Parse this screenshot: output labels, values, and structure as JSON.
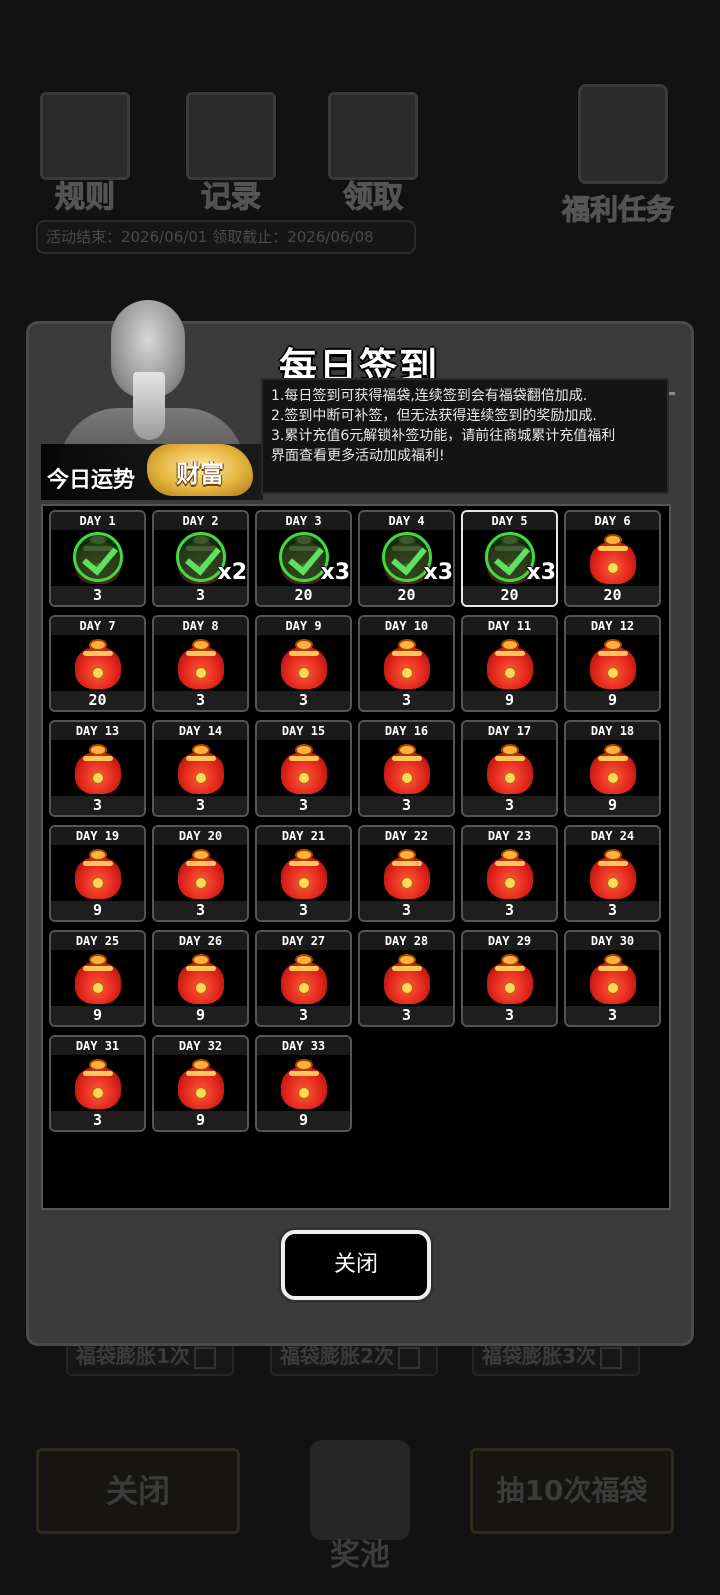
{
  "background": {
    "top_icons": [
      {
        "label": "规则",
        "icon": "rulebook-icon"
      },
      {
        "label": "记录",
        "icon": "record-icon"
      },
      {
        "label": "领取",
        "icon": "claim-icon"
      }
    ],
    "welfare_task": {
      "label": "福利任务",
      "icon": "target-icon"
    },
    "activity_text": "活动结束：2026/06/01  领取截止：2026/06/08",
    "expand_options": [
      "福袋膨胀1次",
      "福袋膨胀2次",
      "福袋膨胀3次"
    ],
    "bottom_close_label": "关闭",
    "prize_pool_label": "奖池",
    "draw10_label": "抽10次福袋"
  },
  "modal": {
    "title": "每日签到",
    "fortune_label": "今日运势",
    "fortune_value": "财富",
    "rules": [
      "1.每日签到可获得福袋,连续签到会有福袋翻倍加成.",
      "2.签到中断可补签，但无法获得连续签到的奖励加成.",
      "3.累计充值6元解锁补签功能，请前往商城累计充值福利",
      "界面查看更多活动加成福利!"
    ],
    "close_label": "关闭"
  },
  "days": [
    {
      "day": "DAY 1",
      "amount": "3",
      "signed": true,
      "mult": ""
    },
    {
      "day": "DAY 2",
      "amount": "3",
      "signed": true,
      "mult": "x2"
    },
    {
      "day": "DAY 3",
      "amount": "20",
      "signed": true,
      "mult": "x3"
    },
    {
      "day": "DAY 4",
      "amount": "20",
      "signed": true,
      "mult": "x3"
    },
    {
      "day": "DAY 5",
      "amount": "20",
      "signed": true,
      "mult": "x3",
      "selected": true
    },
    {
      "day": "DAY 6",
      "amount": "20"
    },
    {
      "day": "DAY 7",
      "amount": "20"
    },
    {
      "day": "DAY 8",
      "amount": "3"
    },
    {
      "day": "DAY 9",
      "amount": "3"
    },
    {
      "day": "DAY 10",
      "amount": "3"
    },
    {
      "day": "DAY 11",
      "amount": "9"
    },
    {
      "day": "DAY 12",
      "amount": "9"
    },
    {
      "day": "DAY 13",
      "amount": "3"
    },
    {
      "day": "DAY 14",
      "amount": "3"
    },
    {
      "day": "DAY 15",
      "amount": "3"
    },
    {
      "day": "DAY 16",
      "amount": "3"
    },
    {
      "day": "DAY 17",
      "amount": "3"
    },
    {
      "day": "DAY 18",
      "amount": "9"
    },
    {
      "day": "DAY 19",
      "amount": "9"
    },
    {
      "day": "DAY 20",
      "amount": "3"
    },
    {
      "day": "DAY 21",
      "amount": "3"
    },
    {
      "day": "DAY 22",
      "amount": "3"
    },
    {
      "day": "DAY 23",
      "amount": "3"
    },
    {
      "day": "DAY 24",
      "amount": "3"
    },
    {
      "day": "DAY 25",
      "amount": "9"
    },
    {
      "day": "DAY 26",
      "amount": "9"
    },
    {
      "day": "DAY 27",
      "amount": "3"
    },
    {
      "day": "DAY 28",
      "amount": "3"
    },
    {
      "day": "DAY 29",
      "amount": "3"
    },
    {
      "day": "DAY 30",
      "amount": "3"
    },
    {
      "day": "DAY 31",
      "amount": "3"
    },
    {
      "day": "DAY 32",
      "amount": "9"
    },
    {
      "day": "DAY 33",
      "amount": "9"
    }
  ]
}
